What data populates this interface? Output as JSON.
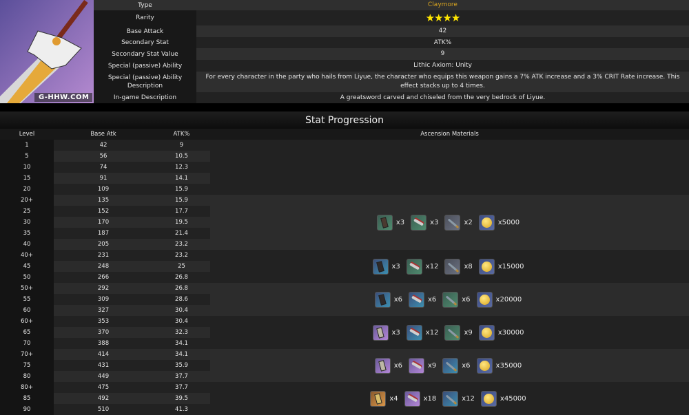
{
  "weapon": {
    "watermark": "G-HHW.COM",
    "info": [
      {
        "label": "Type",
        "value": "Claymore"
      },
      {
        "label": "Rarity",
        "stars": 4,
        "value": "★★★★"
      },
      {
        "label": "Base Attack",
        "value": "42"
      },
      {
        "label": "Secondary Stat",
        "value": "ATK%"
      },
      {
        "label": "Secondary Stat Value",
        "value": "9"
      },
      {
        "label": "Special (passive) Ability",
        "value": "Lithic Axiom: Unity"
      },
      {
        "label": "Special (passive) Ability Description",
        "value": "For every character in the party who hails from Liyue, the character who equips this weapon gains a 7% ATK increase and a 3% CRIT Rate increase. This effect stacks up to 4 times."
      },
      {
        "label": "In-game Description",
        "value": "A greatsword carved and chiseled from the very bedrock of Liyue."
      }
    ]
  },
  "progression": {
    "title": "Stat Progression",
    "headers": [
      "Level",
      "Base Atk",
      "ATK%",
      "Ascension Materials"
    ],
    "rows": [
      [
        "1",
        "42",
        "9"
      ],
      [
        "5",
        "56",
        "10.5"
      ],
      [
        "10",
        "74",
        "12.3"
      ],
      [
        "15",
        "91",
        "14.1"
      ],
      [
        "20",
        "109",
        "15.9"
      ],
      [
        "20+",
        "135",
        "15.9"
      ],
      [
        "25",
        "152",
        "17.7"
      ],
      [
        "30",
        "170",
        "19.5"
      ],
      [
        "35",
        "187",
        "21.4"
      ],
      [
        "40",
        "205",
        "23.2"
      ],
      [
        "40+",
        "231",
        "23.2"
      ],
      [
        "45",
        "248",
        "25"
      ],
      [
        "50",
        "266",
        "26.8"
      ],
      [
        "50+",
        "292",
        "26.8"
      ],
      [
        "55",
        "309",
        "28.6"
      ],
      [
        "60",
        "327",
        "30.4"
      ],
      [
        "60+",
        "353",
        "30.4"
      ],
      [
        "65",
        "370",
        "32.3"
      ],
      [
        "70",
        "388",
        "34.1"
      ],
      [
        "70+",
        "414",
        "34.1"
      ],
      [
        "75",
        "431",
        "35.9"
      ],
      [
        "80",
        "449",
        "37.7"
      ],
      [
        "80+",
        "475",
        "37.7"
      ],
      [
        "85",
        "492",
        "39.5"
      ],
      [
        "90",
        "510",
        "41.3"
      ]
    ],
    "groups": [
      {
        "rows": 5,
        "materials": []
      },
      {
        "rows": 5,
        "materials": [
          {
            "icon": "chip",
            "tier": "g",
            "count": "x3"
          },
          {
            "icon": "blade",
            "tier": "g",
            "count": "x3"
          },
          {
            "icon": "knife",
            "tier": "gr",
            "count": "x2"
          },
          {
            "icon": "coin",
            "tier": "m",
            "count": "x5000"
          }
        ]
      },
      {
        "rows": 3,
        "materials": [
          {
            "icon": "chip",
            "tier": "b",
            "count": "x3"
          },
          {
            "icon": "blade",
            "tier": "g",
            "count": "x12"
          },
          {
            "icon": "knife",
            "tier": "gr",
            "count": "x8"
          },
          {
            "icon": "coin",
            "tier": "m",
            "count": "x15000"
          }
        ]
      },
      {
        "rows": 3,
        "materials": [
          {
            "icon": "chip",
            "tier": "b",
            "count": "x6"
          },
          {
            "icon": "blade",
            "tier": "b",
            "count": "x6"
          },
          {
            "icon": "knife",
            "tier": "g",
            "count": "x6"
          },
          {
            "icon": "coin",
            "tier": "m",
            "count": "x20000"
          }
        ]
      },
      {
        "rows": 3,
        "materials": [
          {
            "icon": "chip",
            "tier": "p",
            "count": "x3"
          },
          {
            "icon": "blade",
            "tier": "b",
            "count": "x12"
          },
          {
            "icon": "knife",
            "tier": "g",
            "count": "x9"
          },
          {
            "icon": "coin",
            "tier": "m",
            "count": "x30000"
          }
        ]
      },
      {
        "rows": 3,
        "materials": [
          {
            "icon": "chip",
            "tier": "p",
            "count": "x6"
          },
          {
            "icon": "blade",
            "tier": "p",
            "count": "x9"
          },
          {
            "icon": "knife",
            "tier": "b",
            "count": "x6"
          },
          {
            "icon": "coin",
            "tier": "m",
            "count": "x35000"
          }
        ]
      },
      {
        "rows": 3,
        "materials": [
          {
            "icon": "chip",
            "tier": "o",
            "count": "x4"
          },
          {
            "icon": "blade",
            "tier": "p",
            "count": "x18"
          },
          {
            "icon": "knife",
            "tier": "b",
            "count": "x12"
          },
          {
            "icon": "coin",
            "tier": "m",
            "count": "x45000"
          }
        ]
      }
    ]
  }
}
